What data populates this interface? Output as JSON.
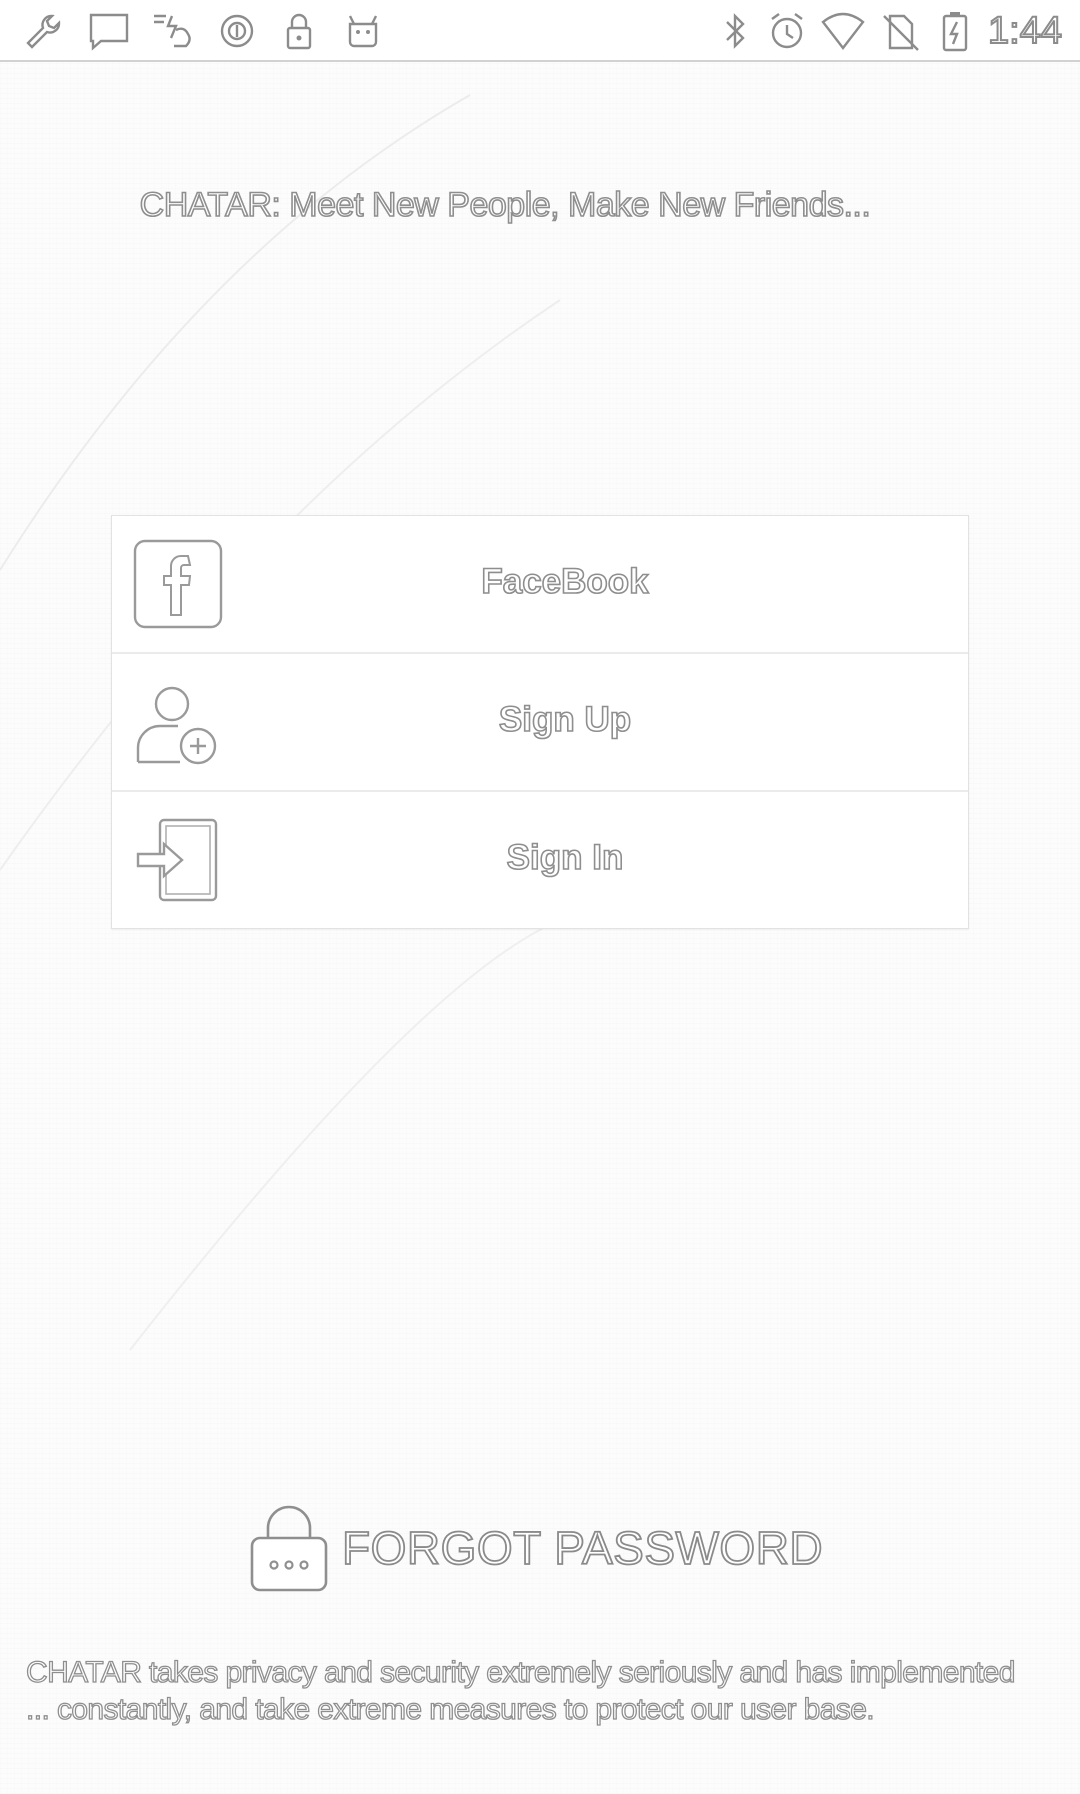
{
  "status_bar": {
    "time": "1:44",
    "left_icons": [
      "wrench-icon",
      "message-icon",
      "weather-icon",
      "circle-status-icon",
      "lock-status-icon",
      "android-icon"
    ],
    "right_icons": [
      "bluetooth-icon",
      "alarm-icon",
      "wifi-icon",
      "no-sim-icon",
      "battery-charging-icon"
    ]
  },
  "tagline": "CHATAR:  Meet New People, Make New Friends...",
  "auth_options": [
    {
      "label": "FaceBook",
      "icon": "facebook-icon"
    },
    {
      "label": "Sign Up",
      "icon": "add-user-icon"
    },
    {
      "label": "Sign In",
      "icon": "sign-in-icon"
    }
  ],
  "forgot_password": {
    "label": "FORGOT PASSWORD",
    "icon": "password-lock-icon"
  },
  "privacy_text": "CHATAR takes privacy and security extremely seriously and has implemented ... constantly, and take extreme measures to protect our user base."
}
